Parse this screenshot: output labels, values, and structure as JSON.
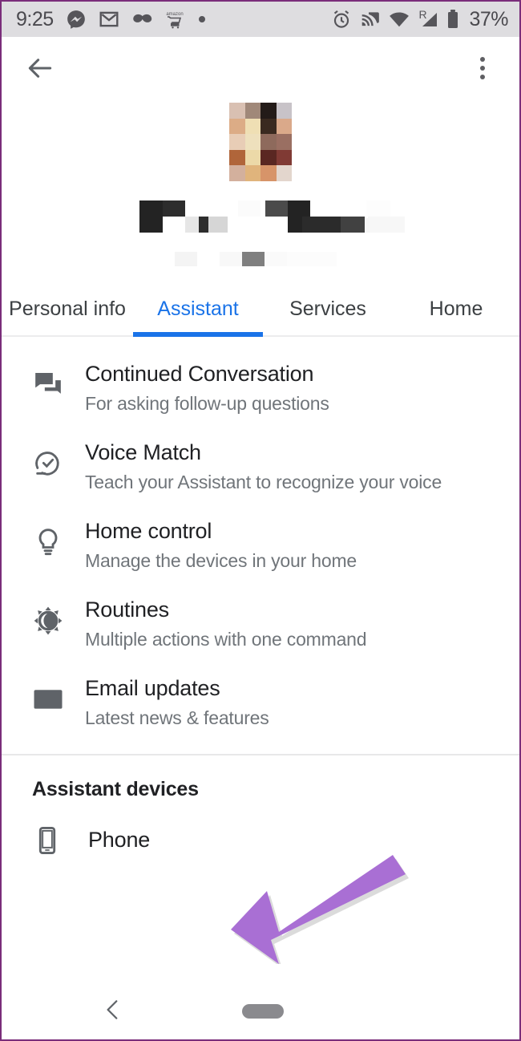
{
  "status_bar": {
    "clock": "9:25",
    "battery_percent": "37%",
    "roaming_indicator": "R",
    "left_icons": [
      "messenger-icon",
      "gmail-icon",
      "mustache-icon",
      "amazon-cart-icon",
      "dot-icon"
    ],
    "right_icons": [
      "alarm-icon",
      "cast-icon",
      "wifi-icon",
      "cellular-signal-icon",
      "battery-icon"
    ],
    "background": "#dedde0",
    "foreground": "#4a494e"
  },
  "app_bar": {
    "back_label": "Back",
    "overflow_label": "More options"
  },
  "profile": {
    "avatar_state": "pixelated",
    "name_state": "pixelated",
    "email_state": "pixelated"
  },
  "tabs": {
    "active": "Assistant",
    "active_color": "#1a73e8",
    "items": [
      {
        "label": "Personal info",
        "active": false
      },
      {
        "label": "Assistant",
        "active": true
      },
      {
        "label": "Services",
        "active": false
      },
      {
        "label": "Home",
        "active": false
      }
    ]
  },
  "settings": {
    "rows": [
      {
        "icon": "question-answer-icon",
        "title": "Continued Conversation",
        "subtitle": "For asking follow-up questions"
      },
      {
        "icon": "voice-match-check-icon",
        "title": "Voice Match",
        "subtitle": "Teach your Assistant to recognize your voice"
      },
      {
        "icon": "lightbulb-icon",
        "title": "Home control",
        "subtitle": "Manage the devices in your home"
      },
      {
        "icon": "routines-sun-moon-icon",
        "title": "Routines",
        "subtitle": "Multiple actions with one command"
      },
      {
        "icon": "envelope-icon",
        "title": "Email updates",
        "subtitle": "Latest news & features"
      }
    ]
  },
  "devices": {
    "heading": "Assistant devices",
    "items": [
      {
        "icon": "smartphone-icon",
        "label": "Phone"
      }
    ]
  },
  "annotation": {
    "type": "arrow",
    "color": "#a96fd4",
    "points_to": "Phone",
    "direction": "left-down"
  },
  "bottom_nav": {
    "back_icon": "chevron-left-icon",
    "home_pill_icon": "home-handle-icon",
    "pill_color": "#8a8a8e"
  },
  "frame": {
    "border_color": "#7a2d7a"
  }
}
